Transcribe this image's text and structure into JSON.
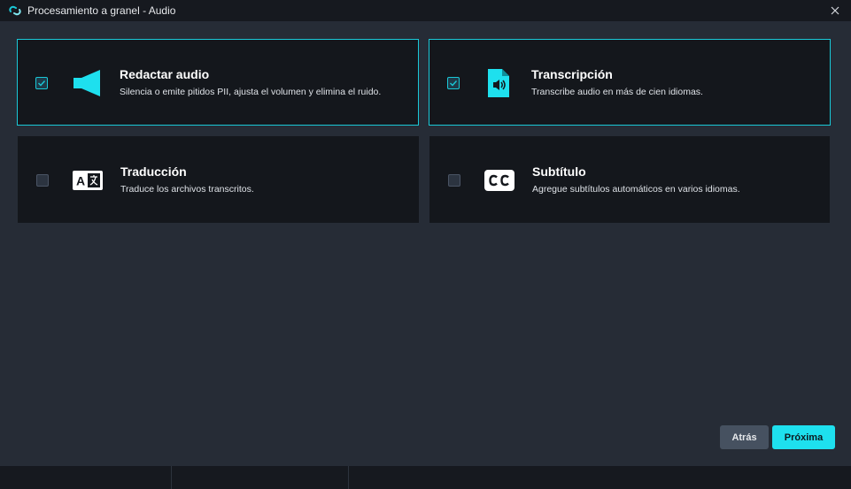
{
  "window": {
    "title": "Procesamiento a granel - Audio",
    "logo_icon": "app-logo-icon",
    "close_icon": "close-icon"
  },
  "options": [
    {
      "title": "Redactar audio",
      "description": "Silencia o emite pitidos PII, ajusta el volumen y elimina el ruido.",
      "checked": true,
      "icon": "speaker-icon"
    },
    {
      "title": "Transcripción",
      "description": "Transcribe audio en más de cien idiomas.",
      "checked": true,
      "icon": "audio-file-icon"
    },
    {
      "title": "Traducción",
      "description": "Traduce los archivos transcritos.",
      "checked": false,
      "icon": "translate-icon"
    },
    {
      "title": "Subtítulo",
      "description": "Agregue subtítulos automáticos en varios idiomas.",
      "checked": false,
      "icon": "closed-caption-icon"
    }
  ],
  "buttons": {
    "back_label": "Atrás",
    "next_label": "Próxima"
  },
  "colors": {
    "accent": "#1ac9d8",
    "card_bg": "#14171c",
    "page_bg": "#262c36"
  }
}
